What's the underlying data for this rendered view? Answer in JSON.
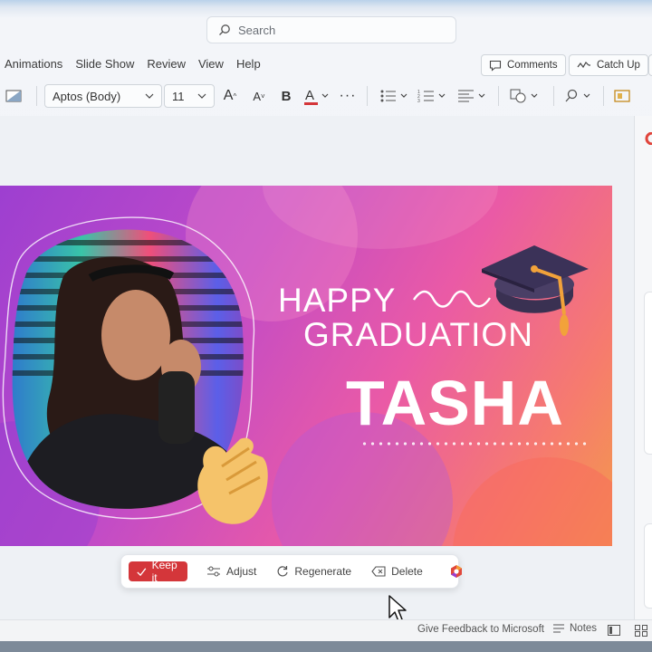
{
  "search": {
    "placeholder": "Search"
  },
  "ribbon_tabs": [
    "Animations",
    "Slide Show",
    "Review",
    "View",
    "Help"
  ],
  "top_buttons": {
    "comments": "Comments",
    "catch_up": "Catch Up"
  },
  "font": {
    "name": "Aptos (Body)",
    "size": "11"
  },
  "slide": {
    "line1": "HAPPY",
    "line2": "GRADUATION",
    "name": "TASHA"
  },
  "ai_bar": {
    "keep": "Keep it",
    "adjust": "Adjust",
    "regenerate": "Regenerate",
    "delete": "Delete"
  },
  "status": {
    "feedback": "Give Feedback to Microsoft",
    "notes": "Notes"
  },
  "colors": {
    "accent_red": "#d4363a",
    "slide_purple": "#9d3fd0",
    "slide_pink": "#ea5aa6",
    "slide_orange": "#f39a4b"
  },
  "icons": [
    "search-icon",
    "comments-icon",
    "catch-up-icon",
    "shape-fill-icon",
    "font-grow-icon",
    "font-shrink-icon",
    "bold-icon",
    "font-color-icon",
    "more-icon",
    "bullets-icon",
    "numbering-icon",
    "align-icon",
    "shapes-icon",
    "find-icon",
    "designer-icon",
    "check-icon",
    "adjust-icon",
    "regenerate-icon",
    "delete-icon",
    "copilot-icon",
    "notes-icon",
    "view-normal-icon",
    "view-grid-icon",
    "cursor-icon"
  ]
}
